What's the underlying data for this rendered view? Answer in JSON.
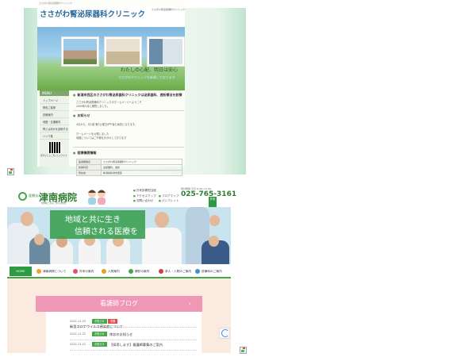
{
  "colors": {
    "clinic_green": "#7ea76f",
    "clinic_blue_title": "#2a6a9a",
    "hospital_green": "#2e9b44",
    "hospital_pink": "#ef98b6",
    "hospital_bg": "#fbeadf"
  },
  "clinic": {
    "tiny_bar": "ささがわ腎泌尿器科クリニック",
    "title": "ささがわ腎泌尿器科クリニック",
    "header_info": "ささがわ腎泌尿器科クリニック",
    "banner_caption_main": "わたしの心配、明日は安心",
    "banner_caption_sub": "ささがわクリニックを新規しております",
    "menu_head": "MENU",
    "menu_items": [
      "トップページ",
      "院長ご挨拶",
      "診療案内",
      "地図・交通案内",
      "腎とは何かを説明する",
      "リンク集"
    ],
    "qr_note": "携帯からもご覧いただけます",
    "sections": [
      {
        "heading": "新潟市西区のささがわ腎泌尿器科クリニックは泌尿器科、透析療法を診療",
        "lines": [
          "ささがわ腎泌尿器科クリニックのホームページへようこそ",
          "2009年5月に開院しました。"
        ]
      },
      {
        "heading": "お知らせ",
        "lines": [
          "4月から、月1回 第3土曜日が午後も休診になります。",
          "ホームページを公開しました",
          "地図についてはご不便をおかけしております"
        ]
      },
      {
        "heading": "医療機関情報",
        "lines": []
      }
    ],
    "table": [
      [
        "医療機関名",
        "ささがわ腎泌尿器科クリニック"
      ],
      [
        "診療科目",
        "泌尿器科、透析"
      ],
      [
        "所在地",
        "新潟県新潟市西区"
      ]
    ]
  },
  "hospital": {
    "logo_pre": "医療法人",
    "logo_name": "津南病院",
    "logo_sub": "地域と共に歩む病院",
    "head_links": [
      "外来診察担当医",
      "アクセスマップ",
      "フロアマップ",
      "お問い合わせ",
      "パンフレット"
    ],
    "phone_label": "受付時間 平日 8:30～17:00",
    "phone": "025-765-3161",
    "side_button": "外来",
    "hero_line1": "地域と共に生き",
    "hero_line2": "信頼される医療を",
    "nav": [
      {
        "label": "HOME",
        "color": "#2e9b44"
      },
      {
        "label": "津南病院について",
        "color": "#f0a030"
      },
      {
        "label": "外来の案内",
        "color": "#e05070"
      },
      {
        "label": "入院案内",
        "color": "#e0a020"
      },
      {
        "label": "健診の案内",
        "color": "#46a64a"
      },
      {
        "label": "求人・入院のご案内",
        "color": "#d04040"
      },
      {
        "label": "診療科のご案内",
        "color": "#4090d0"
      }
    ],
    "blog_title": "看護師ブログ",
    "blog_arrow": "›",
    "news": [
      {
        "date": "2022.11.25",
        "tags": [
          {
            "label": "お知らせ",
            "color": "#46a64a"
          },
          {
            "label": "重要",
            "color": "#e05050"
          }
        ],
        "title": "新型コロナウイルス感染症について"
      },
      {
        "date": "2022.11.22",
        "tags": [
          {
            "label": "お知らせ",
            "color": "#46a64a"
          }
        ],
        "title": "休診のお知らせ"
      },
      {
        "date": "2022.11.21",
        "tags": [
          {
            "label": "お知らせ",
            "color": "#46a64a"
          }
        ],
        "title": "【採用します】看護師募集のご案内"
      }
    ]
  }
}
